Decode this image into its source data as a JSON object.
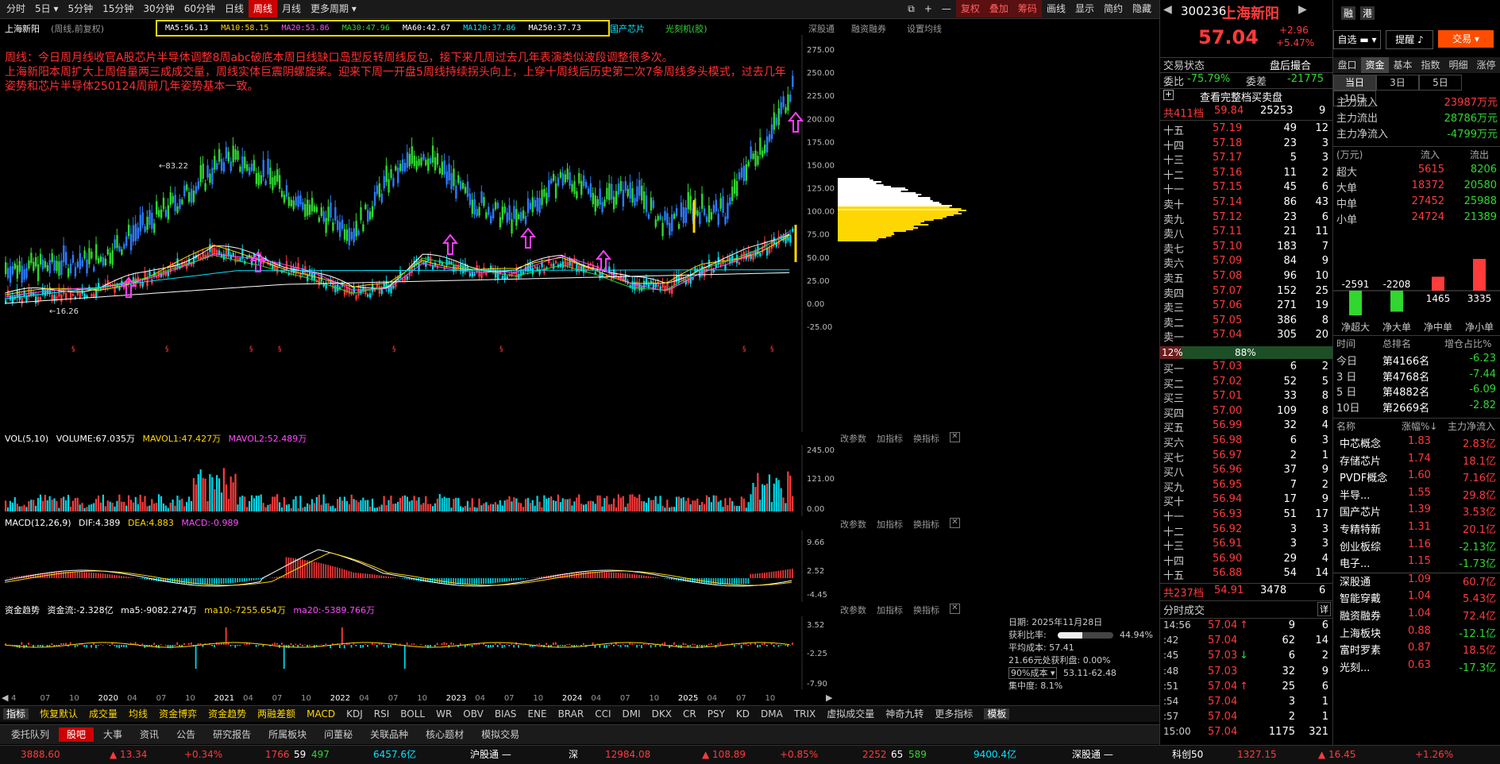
{
  "toolbar": {
    "periods": [
      "分时",
      "5日",
      "5分钟",
      "15分钟",
      "30分钟",
      "60分钟",
      "日线",
      "周线",
      "月线",
      "更多周期"
    ],
    "active": "周线",
    "right_buttons": [
      "复权",
      "叠加",
      "筹码",
      "画线",
      "显示",
      "简约",
      "隐藏"
    ]
  },
  "chart_header": {
    "stock": "上海新阳",
    "mode": "(周线,前复权)",
    "ma5": "MA5:56.13",
    "ma10": "MA10:58.15",
    "ma20": "MA20:53.86",
    "ma30": "MA30:47.96",
    "ma60": "MA60:42.67",
    "ma120": "MA120:37.86",
    "ma250": "MA250:37.73",
    "tags": [
      "国产芯片",
      "光刻机(胶)"
    ],
    "links": [
      "深股通",
      "融资融券",
      "设置均线"
    ]
  },
  "annotation": {
    "line1": "周线：今日周月线收官A股芯片半导体调整8周abc破底本周日线缺口岛型反转周线反包，接下来几周过去几年表演类似波段调整很多次。",
    "line2": "上海新阳本周扩大上周倍量两三成成交量，周线实体巨震阴螺旋桨。迎来下周一开盘5周线持续拐头向上，上穿十周线后历史第二次7条周线多头模式，过去几年",
    "line3": "姿势和芯片半导体250124周前几年姿势基本一致。"
  },
  "price_axis": [
    "275.00",
    "250.00",
    "225.00",
    "200.00",
    "175.00",
    "150.00",
    "125.00",
    "100.00",
    "75.00",
    "50.00",
    "25.00",
    "0.00",
    "-25.00"
  ],
  "markers": {
    "high": "83.22",
    "low": "16.26"
  },
  "volume_panel": {
    "title": "VOL(5,10)",
    "volume": "VOLUME:67.035万",
    "mavol1": "MAVOL1:47.427万",
    "mavol2": "MAVOL2:52.489万",
    "axis": [
      "245.00",
      "121.00",
      "0.00"
    ],
    "buttons": [
      "改参数",
      "加指标",
      "换指标"
    ]
  },
  "macd_panel": {
    "title": "MACD(12,26,9)",
    "dif": "DIF:4.389",
    "dea": "DEA:4.883",
    "macd": "MACD:-0.989",
    "axis": [
      "9.66",
      "2.52",
      "-4.45"
    ],
    "buttons": [
      "改参数",
      "加指标",
      "换指标"
    ]
  },
  "flow_panel": {
    "title": "资金趋势",
    "flow": "资金流:-2.328亿",
    "ma5": "ma5:-9082.274万",
    "ma10": "ma10:-7255.654万",
    "ma20": "ma20:-5389.766万",
    "axis": [
      "3.52",
      "-2.25",
      "-7.90"
    ],
    "buttons": [
      "改参数",
      "加指标",
      "换指标"
    ]
  },
  "chip_info": {
    "date": "日期: 2025年11月28日",
    "profit_ratio_label": "获利比率:",
    "profit_ratio": "44.94%",
    "profit_fraction": 0.4494,
    "avg_cost": "平均成本: 57.41",
    "profit_line": "21.66元处获利盘: 0.00%",
    "cost_select": "90%成本",
    "cost_range": "53.11-62.48",
    "concentration": "集中度: 8.1%"
  },
  "x_axis": [
    "4",
    "07",
    "10",
    "2020",
    "04",
    "07",
    "10",
    "2021",
    "04",
    "07",
    "10",
    "2022",
    "04",
    "07",
    "10",
    "2023",
    "04",
    "07",
    "10",
    "2024",
    "04",
    "07",
    "10",
    "2025",
    "04",
    "07",
    "10"
  ],
  "indicator_tabs": [
    "指标",
    "恢复默认",
    "成交量",
    "均线",
    "资金博弈",
    "资金趋势",
    "两融差额",
    "MACD",
    "KDJ",
    "RSI",
    "BOLL",
    "WR",
    "OBV",
    "BIAS",
    "ENE",
    "BRAR",
    "CCI",
    "DMI",
    "DKX",
    "CR",
    "PSY",
    "KD",
    "DMA",
    "TRIX",
    "虚拟成交量",
    "神奇九转",
    "更多指标",
    "模板"
  ],
  "bottom_tabs": [
    "委托队列",
    "股吧",
    "大事",
    "资讯",
    "公告",
    "研究报告",
    "所属板块",
    "问董秘",
    "关联品种",
    "核心题材",
    "模拟交易"
  ],
  "status_bar": {
    "sh_index": "3888.60",
    "sh_chg": "▲ 13.34",
    "sh_pct": "+0.34%",
    "sh_up": "1766",
    "sh_flat": "59",
    "sh_down": "497",
    "sh_amt": "6457.6亿",
    "hgt": "沪股通 —",
    "sz_label": "深",
    "sz_index": "12984.08",
    "sz_chg": "▲ 108.89",
    "sz_pct": "+0.85%",
    "sz_up": "2252",
    "sz_flat": "65",
    "sz_down": "589",
    "sz_amt": "9400.4亿",
    "sgt": "深股通 —",
    "kc_label": "科创50",
    "kc_index": "1327.15",
    "kc_chg": "▲ 16.45",
    "kc_pct": "+1.26%"
  },
  "quote": {
    "code": "300236",
    "name": "上海新阳",
    "price": "57.04",
    "change": "+2.96",
    "pct": "+5.47%",
    "btn_pick": "自选",
    "btn_alert": "提醒",
    "btn_trade": "交易",
    "tab_rong": "融",
    "tab_gang": "港",
    "trade_status": "交易状态",
    "trade_status_val": "盘后撮合",
    "wb_label": "委比",
    "wb_val": "-75.79%",
    "wc_label": "委差",
    "wc_val": "-21775",
    "full_book": "查看完整档买卖盘",
    "sell_total_label": "共411档",
    "sell_total_price": "59.84",
    "sell_total_vol": "25253",
    "sell_total_cnt": "9",
    "buy_total_label": "共237档",
    "buy_total_price": "54.91",
    "buy_total_vol": "3478",
    "buy_total_cnt": "6",
    "ratio_left": "12%",
    "ratio_right": "88%"
  },
  "sells": [
    {
      "label": "十五",
      "price": "57.19",
      "vol": "49",
      "cnt": "12"
    },
    {
      "label": "十四",
      "price": "57.18",
      "vol": "23",
      "cnt": "3"
    },
    {
      "label": "十三",
      "price": "57.17",
      "vol": "5",
      "cnt": "3"
    },
    {
      "label": "十二",
      "price": "57.16",
      "vol": "11",
      "cnt": "2"
    },
    {
      "label": "十一",
      "price": "57.15",
      "vol": "45",
      "cnt": "6"
    },
    {
      "label": "卖十",
      "price": "57.14",
      "vol": "86",
      "cnt": "43"
    },
    {
      "label": "卖九",
      "price": "57.12",
      "vol": "23",
      "cnt": "6"
    },
    {
      "label": "卖八",
      "price": "57.11",
      "vol": "21",
      "cnt": "11"
    },
    {
      "label": "卖七",
      "price": "57.10",
      "vol": "183",
      "cnt": "7"
    },
    {
      "label": "卖六",
      "price": "57.09",
      "vol": "84",
      "cnt": "9"
    },
    {
      "label": "卖五",
      "price": "57.08",
      "vol": "96",
      "cnt": "10"
    },
    {
      "label": "卖四",
      "price": "57.07",
      "vol": "152",
      "cnt": "25"
    },
    {
      "label": "卖三",
      "price": "57.06",
      "vol": "271",
      "cnt": "19"
    },
    {
      "label": "卖二",
      "price": "57.05",
      "vol": "386",
      "cnt": "8"
    },
    {
      "label": "卖一",
      "price": "57.04",
      "vol": "305",
      "cnt": "20"
    }
  ],
  "buys": [
    {
      "label": "买一",
      "price": "57.03",
      "vol": "6",
      "cnt": "2"
    },
    {
      "label": "买二",
      "price": "57.02",
      "vol": "52",
      "cnt": "5"
    },
    {
      "label": "买三",
      "price": "57.01",
      "vol": "33",
      "cnt": "8"
    },
    {
      "label": "买四",
      "price": "57.00",
      "vol": "109",
      "cnt": "8"
    },
    {
      "label": "买五",
      "price": "56.99",
      "vol": "32",
      "cnt": "4"
    },
    {
      "label": "买六",
      "price": "56.98",
      "vol": "6",
      "cnt": "3"
    },
    {
      "label": "买七",
      "price": "56.97",
      "vol": "2",
      "cnt": "1"
    },
    {
      "label": "买八",
      "price": "56.96",
      "vol": "37",
      "cnt": "9"
    },
    {
      "label": "买九",
      "price": "56.95",
      "vol": "7",
      "cnt": "2"
    },
    {
      "label": "买十",
      "price": "56.94",
      "vol": "17",
      "cnt": "9"
    },
    {
      "label": "十一",
      "price": "56.93",
      "vol": "51",
      "cnt": "17"
    },
    {
      "label": "十二",
      "price": "56.92",
      "vol": "3",
      "cnt": "3"
    },
    {
      "label": "十三",
      "price": "56.91",
      "vol": "3",
      "cnt": "3"
    },
    {
      "label": "十四",
      "price": "56.90",
      "vol": "29",
      "cnt": "4"
    },
    {
      "label": "十五",
      "price": "56.88",
      "vol": "54",
      "cnt": "14"
    }
  ],
  "ticks_title": "分时成交",
  "ticks_more": "详",
  "ticks": [
    {
      "t": "14:56",
      "p": "57.04",
      "arrow": "up",
      "v": "9",
      "n": "6"
    },
    {
      "t": ":42",
      "p": "57.04",
      "arrow": "",
      "v": "62",
      "n": "14"
    },
    {
      "t": ":45",
      "p": "57.03",
      "arrow": "down",
      "v": "6",
      "n": "2"
    },
    {
      "t": ":48",
      "p": "57.03",
      "arrow": "",
      "v": "32",
      "n": "9"
    },
    {
      "t": ":51",
      "p": "57.04",
      "arrow": "up",
      "v": "25",
      "n": "6"
    },
    {
      "t": ":54",
      "p": "57.04",
      "arrow": "",
      "v": "3",
      "n": "1"
    },
    {
      "t": ":57",
      "p": "57.04",
      "arrow": "",
      "v": "2",
      "n": "1"
    },
    {
      "t": "15:00",
      "p": "57.04",
      "arrow": "",
      "v": "1175",
      "n": "321"
    }
  ],
  "flow_tabs": [
    "盘口",
    "资金",
    "基本",
    "指数",
    "明细",
    "涨停"
  ],
  "flow_period_tabs": [
    "当日",
    "3日",
    "5日",
    "10日"
  ],
  "main_flow": [
    {
      "label": "主力流入",
      "value": "23987万元"
    },
    {
      "label": "主力流出",
      "value": "28786万元"
    },
    {
      "label": "主力净流入",
      "value": "-4799万元"
    }
  ],
  "flow_table_head": [
    "(万元)",
    "流入",
    "流出"
  ],
  "flow_table": [
    {
      "label": "超大",
      "in": "5615",
      "out": "8206"
    },
    {
      "label": "大单",
      "in": "18372",
      "out": "20580"
    },
    {
      "label": "中单",
      "in": "27452",
      "out": "25988"
    },
    {
      "label": "小单",
      "in": "24724",
      "out": "21389"
    }
  ],
  "net_bars": [
    {
      "label": "净超大",
      "value": -2591,
      "text": "-2591"
    },
    {
      "label": "净大单",
      "value": -2208,
      "text": "-2208"
    },
    {
      "label": "净中单",
      "value": 1465,
      "text": "1465"
    },
    {
      "label": "净小单",
      "value": 3335,
      "text": "3335"
    }
  ],
  "rank_head": [
    "时间",
    "总排名",
    "增仓占比%"
  ],
  "ranks": [
    {
      "t": "今日",
      "rank": "第4166名",
      "pct": "-6.23"
    },
    {
      "t": "3 日",
      "rank": "第4768名",
      "pct": "-7.44"
    },
    {
      "t": "5 日",
      "rank": "第4882名",
      "pct": "-6.09"
    },
    {
      "t": "10日",
      "rank": "第2669名",
      "pct": "-2.82"
    }
  ],
  "sector_head": [
    "名称",
    "涨幅%↓",
    "主力净流入"
  ],
  "sectors": [
    {
      "name": "中芯概念",
      "pct": "1.83",
      "flow": "2.83亿",
      "neg": false
    },
    {
      "name": "存储芯片",
      "pct": "1.74",
      "flow": "18.1亿",
      "neg": false
    },
    {
      "name": "PVDF概念",
      "pct": "1.60",
      "flow": "7.16亿",
      "neg": false
    },
    {
      "name": "半导...",
      "pct": "1.55",
      "flow": "29.8亿",
      "neg": false
    },
    {
      "name": "国产芯片",
      "pct": "1.39",
      "flow": "3.53亿",
      "neg": false
    },
    {
      "name": "专精特新",
      "pct": "1.31",
      "flow": "20.1亿",
      "neg": false
    },
    {
      "name": "创业板综",
      "pct": "1.16",
      "flow": "-2.13亿",
      "neg": true
    },
    {
      "name": "电子...",
      "pct": "1.15",
      "flow": "-1.73亿",
      "neg": true
    },
    {
      "name": "深股通",
      "pct": "1.09",
      "flow": "60.7亿",
      "neg": false
    },
    {
      "name": "智能穿戴",
      "pct": "1.04",
      "flow": "5.43亿",
      "neg": false
    },
    {
      "name": "融资融券",
      "pct": "1.04",
      "flow": "72.4亿",
      "neg": false
    },
    {
      "name": "上海板块",
      "pct": "0.88",
      "flow": "-12.1亿",
      "neg": true
    },
    {
      "name": "富时罗素",
      "pct": "0.87",
      "flow": "18.5亿",
      "neg": false
    },
    {
      "name": "光刻...",
      "pct": "0.63",
      "flow": "-17.3亿",
      "neg": true
    }
  ]
}
